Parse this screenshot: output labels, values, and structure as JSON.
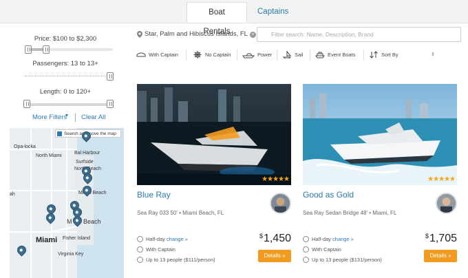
{
  "tabs": [
    {
      "label": "Boat Rentals",
      "active": true
    },
    {
      "label": "Captains",
      "active": false
    }
  ],
  "filters": {
    "price_label": "Price: $100 to $2,300",
    "passengers_label": "Passengers: 13 to 13+",
    "length_label": "Length: 0 to 120+",
    "more_filters": "More Filters",
    "clear_all": "Clear All"
  },
  "map": {
    "search_toggle": "Search as I move the map",
    "labels": {
      "opa_locka": "Opa-locka",
      "north_miami": "North Miami",
      "bal_harbour": "Bal Harbour",
      "surfside": "Surfside",
      "north_beach": "North Beach",
      "miami_beach": "Miami Beach",
      "miami": "Miami",
      "fisher_island": "Fisher Island",
      "virginia_key": "Virginia Key",
      "beach_tail": "Beach",
      "hialeah_tail": "ah",
      "m_tail": "M"
    }
  },
  "search": {
    "location": "Star, Palm and Hibiscus Islands, FL",
    "placeholder": "Filter search: Name, Description, Brand"
  },
  "chips": [
    {
      "label": "With Captain",
      "icon": "captain-hat-icon"
    },
    {
      "label": "No Captain",
      "icon": "ship-wheel-icon"
    },
    {
      "label": "Power",
      "icon": "power-boat-icon"
    },
    {
      "label": "Sail",
      "icon": "sailboat-icon"
    },
    {
      "label": "Event Boats",
      "icon": "event-boat-icon"
    },
    {
      "label": "Sort By",
      "icon": "sort-icon"
    }
  ],
  "listings": [
    {
      "title": "Blue Ray",
      "subtitle": "Sea Ray 033 50'  •  Miami Beach, FL",
      "duration": "Half-day",
      "change": "change »",
      "captain": "With Captain",
      "capacity": "Up to 13 people",
      "per_person": "($111/person)",
      "currency": "$",
      "price": "1,450",
      "details": "Details »",
      "rating": 5
    },
    {
      "title": "Good as Gold",
      "subtitle": "Sea Ray Sedan Bridge 48'  •  Miami, FL",
      "duration": "Half-day",
      "change": "change »",
      "captain": "With Captain",
      "capacity": "Up to 13 people",
      "per_person": "($131/person)",
      "currency": "$",
      "price": "1,705",
      "details": "Details »",
      "rating": 5
    }
  ],
  "colors": {
    "accent": "#2a7ab0",
    "button": "#f39b1f",
    "star": "#f4a50c"
  }
}
